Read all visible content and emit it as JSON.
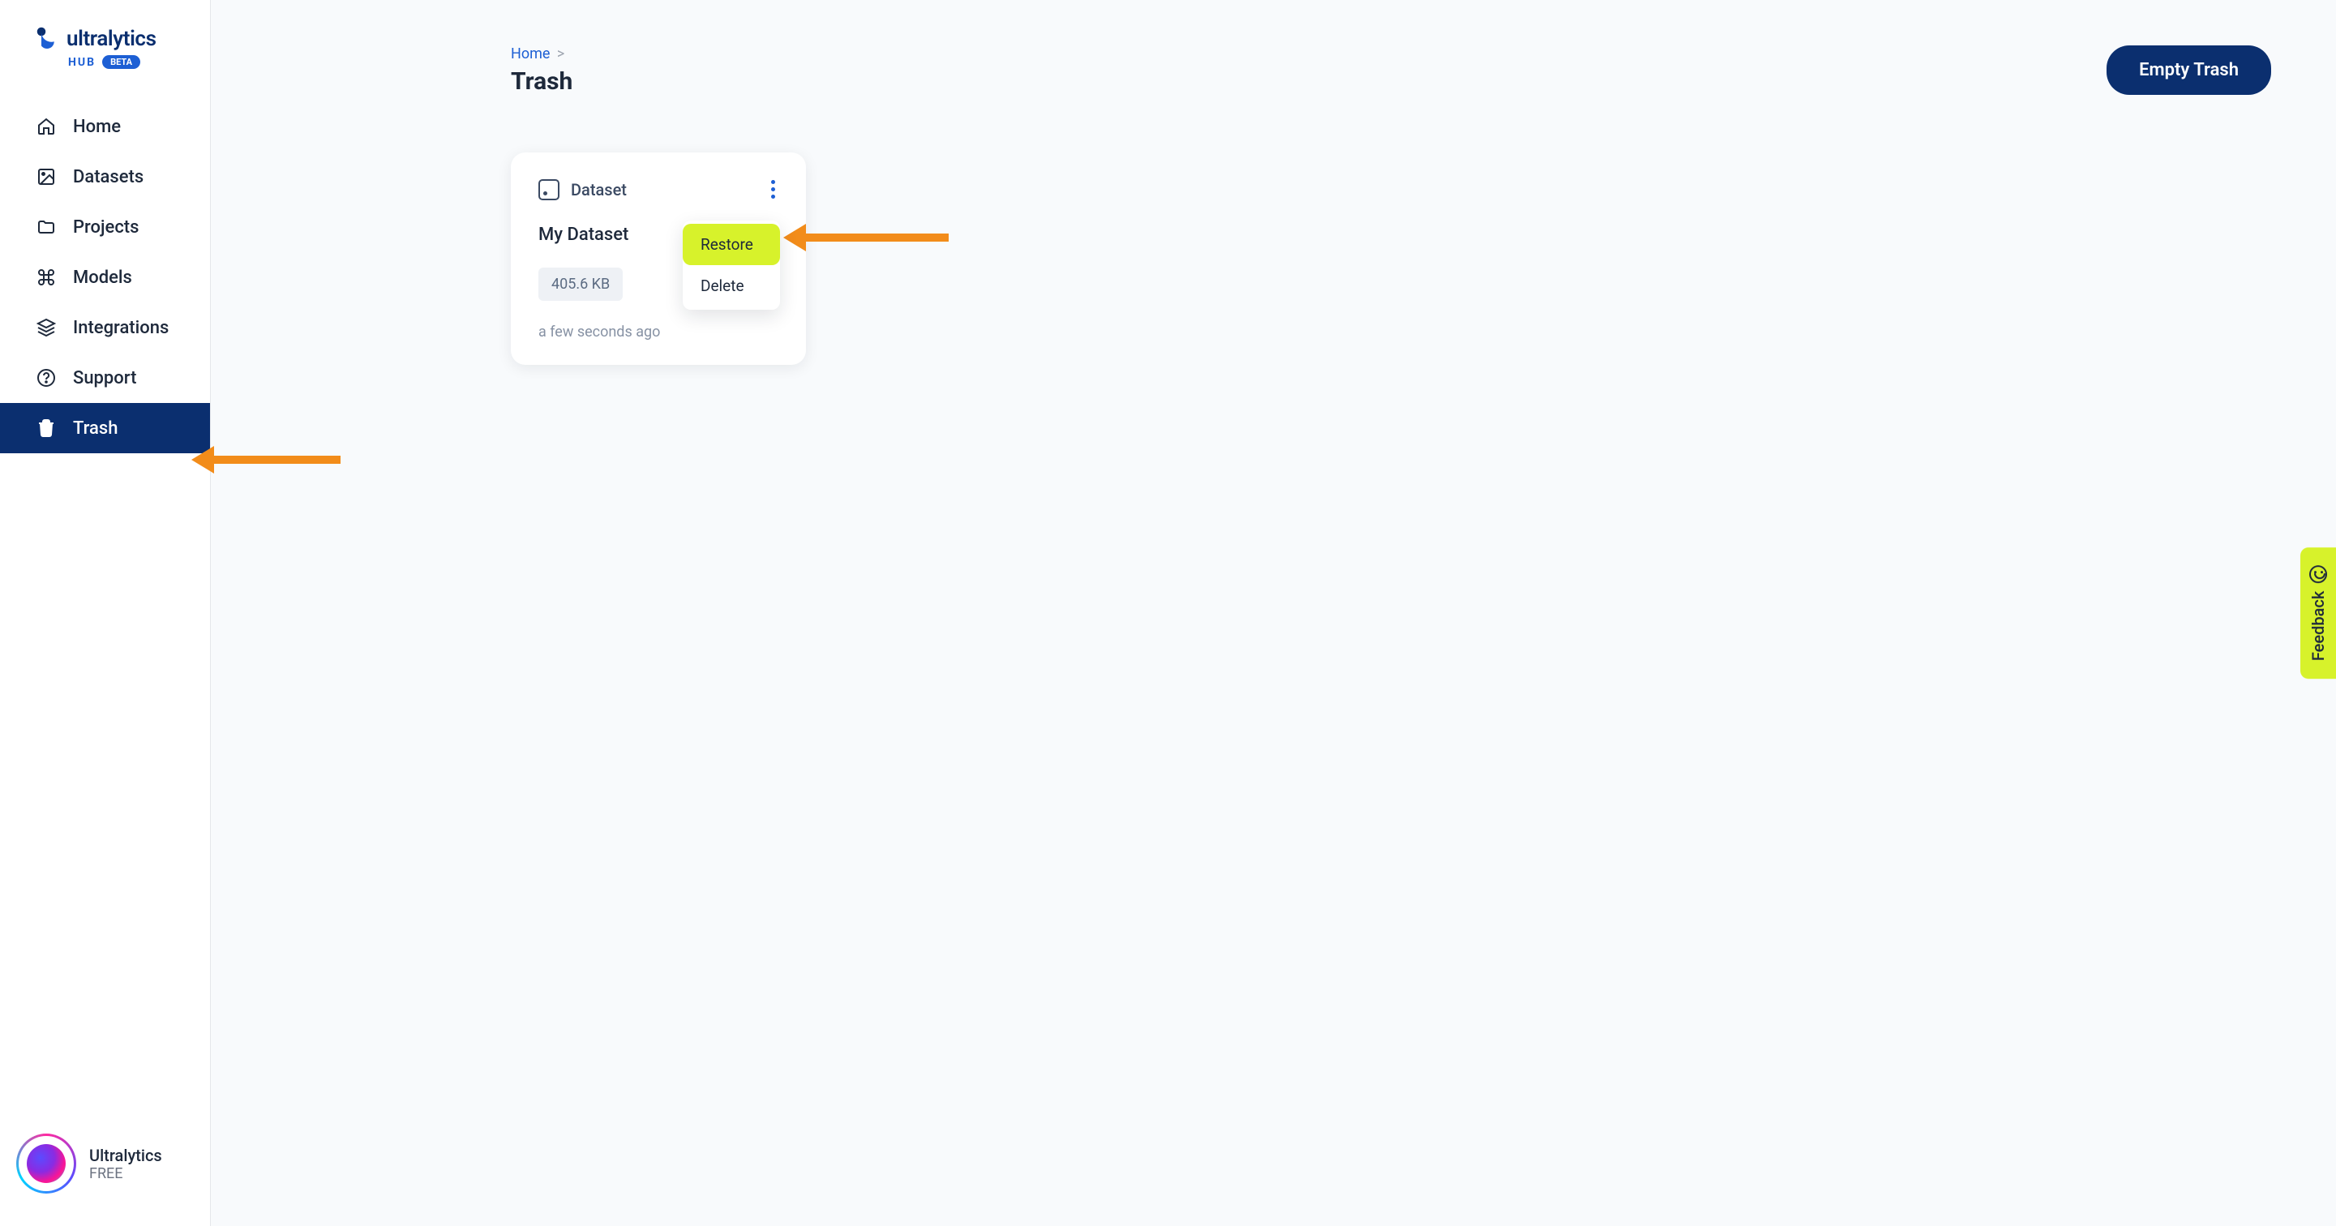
{
  "app": {
    "name": "ultralytics",
    "hub_label": "HUB",
    "beta_label": "BETA"
  },
  "sidebar": {
    "items": [
      {
        "label": "Home",
        "active": false,
        "icon": "home-icon"
      },
      {
        "label": "Datasets",
        "active": false,
        "icon": "image-icon"
      },
      {
        "label": "Projects",
        "active": false,
        "icon": "folder-icon"
      },
      {
        "label": "Models",
        "active": false,
        "icon": "command-icon"
      },
      {
        "label": "Integrations",
        "active": false,
        "icon": "layers-icon"
      },
      {
        "label": "Support",
        "active": false,
        "icon": "help-icon"
      },
      {
        "label": "Trash",
        "active": true,
        "icon": "trash-icon"
      }
    ]
  },
  "user": {
    "name": "Ultralytics",
    "plan": "FREE"
  },
  "breadcrumb": {
    "home": "Home",
    "sep": ">"
  },
  "page": {
    "title": "Trash"
  },
  "actions": {
    "empty_trash": "Empty Trash"
  },
  "card": {
    "type_label": "Dataset",
    "name": "My Dataset",
    "size": "405.6 KB",
    "time": "a few seconds ago",
    "menu": {
      "restore": "Restore",
      "delete": "Delete"
    }
  },
  "feedback": {
    "label": "Feedback"
  }
}
